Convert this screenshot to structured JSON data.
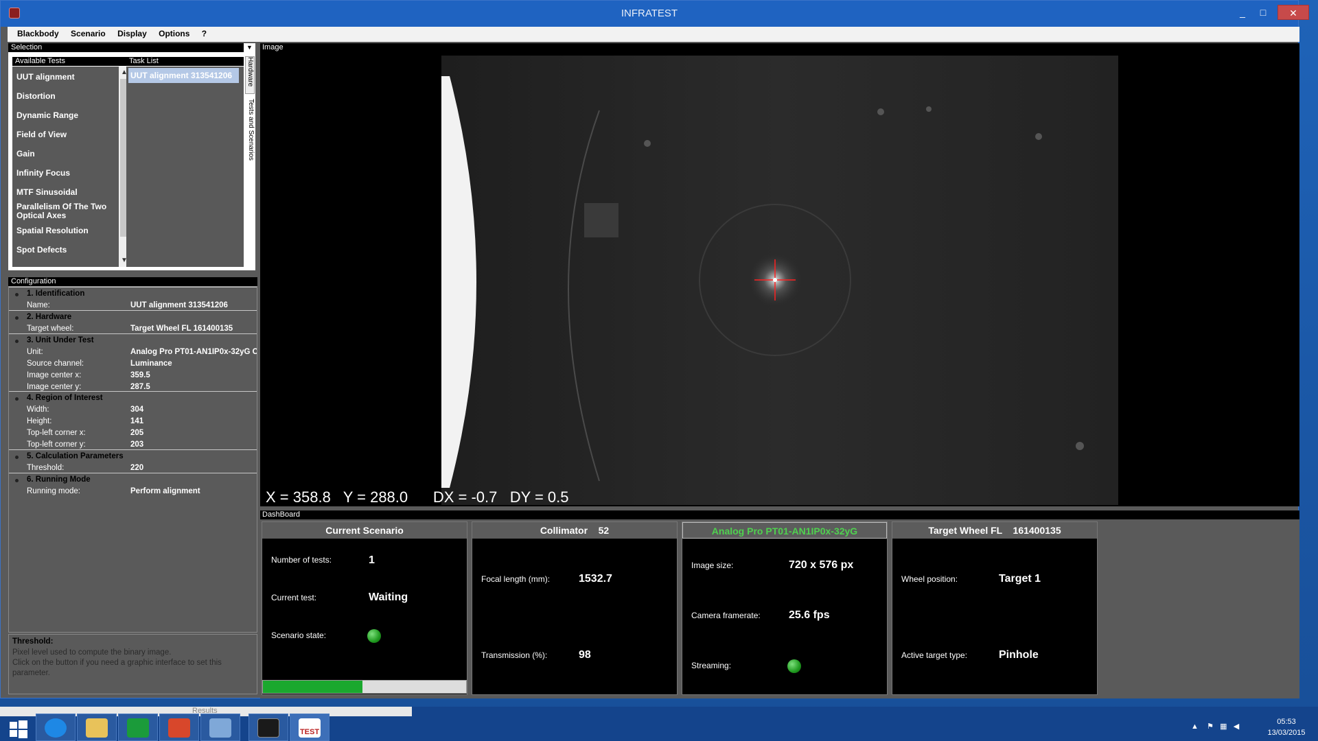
{
  "window": {
    "title": "INFRATEST",
    "min": "_",
    "max": "□",
    "close": "✕"
  },
  "menu": [
    "Blackbody",
    "Scenario",
    "Display",
    "Options",
    "?"
  ],
  "selection": {
    "header": "Selection",
    "available_header": "Available Tests",
    "available": [
      "UUT alignment",
      "Distortion",
      "Dynamic Range",
      "Field of View",
      "Gain",
      "Infinity Focus",
      "MTF Sinusoidal",
      "Parallelism Of The Two Optical Axes",
      "Spatial Resolution",
      "Spot Defects"
    ],
    "task_header": "Task List",
    "tasks": [
      "UUT alignment 313541206"
    ],
    "tabs": [
      "Hardware",
      "Tests and Scenarios"
    ]
  },
  "configuration": {
    "header": "Configuration",
    "groups": [
      {
        "title": "1. Identification",
        "rows": [
          {
            "label": "Name:",
            "value": "UUT alignment 313541206"
          }
        ]
      },
      {
        "title": "2. Hardware",
        "rows": [
          {
            "label": "Target wheel:",
            "value": "Target Wheel FL 161400135"
          }
        ]
      },
      {
        "title": "3. Unit Under Test",
        "rows": [
          {
            "label": "Unit:",
            "value": "Analog Pro PT01-AN1IP0x-32yG C"
          },
          {
            "label": "Source channel:",
            "value": "Luminance"
          },
          {
            "label": "Image center x:",
            "value": "359.5"
          },
          {
            "label": "Image center y:",
            "value": "287.5"
          }
        ]
      },
      {
        "title": "4. Region of Interest",
        "rows": [
          {
            "label": "Width:",
            "value": "304"
          },
          {
            "label": "Height:",
            "value": "141"
          },
          {
            "label": "Top-left corner x:",
            "value": "205"
          },
          {
            "label": "Top-left corner y:",
            "value": "203"
          }
        ]
      },
      {
        "title": "5. Calculation Parameters",
        "rows": [
          {
            "label": "Threshold:",
            "value": "220"
          }
        ]
      },
      {
        "title": "6. Running Mode",
        "rows": [
          {
            "label": "Running mode:",
            "value": "Perform alignment"
          }
        ]
      }
    ]
  },
  "help": {
    "title": "Threshold:",
    "text": "Pixel level used to compute the binary image.\nClick on the button if you need a graphic interface to set this parameter."
  },
  "image": {
    "header": "Image",
    "readout": "X = 358.8   Y = 288.0      DX = -0.7   DY = 0.5"
  },
  "dashboard": {
    "header": "DashBoard",
    "scenario": {
      "title": "Current Scenario",
      "tests_label": "Number of tests:",
      "tests_value": "1",
      "current_label": "Current test:",
      "current_value": "Waiting",
      "state_label": "Scenario state:",
      "progress": 0.49
    },
    "collimator": {
      "title": "Collimator    52",
      "focal_label": "Focal length (mm):",
      "focal_value": "1532.7",
      "trans_label": "Transmission (%):",
      "trans_value": "98"
    },
    "camera": {
      "title": "Analog Pro PT01-AN1IP0x-32yG",
      "size_label": "Image size:",
      "size_value": "720 x 576 px",
      "fps_label": "Camera framerate:",
      "fps_value": "25.6 fps",
      "stream_label": "Streaming:"
    },
    "wheel": {
      "title": "Target Wheel FL    161400135",
      "pos_label": "Wheel position:",
      "pos_value": "Target 1",
      "type_label": "Active target type:",
      "type_value": "Pinhole"
    }
  },
  "taskbar": {
    "results": "Results",
    "test_label": "TEST",
    "time": "05:53",
    "date": "13/03/2015"
  }
}
